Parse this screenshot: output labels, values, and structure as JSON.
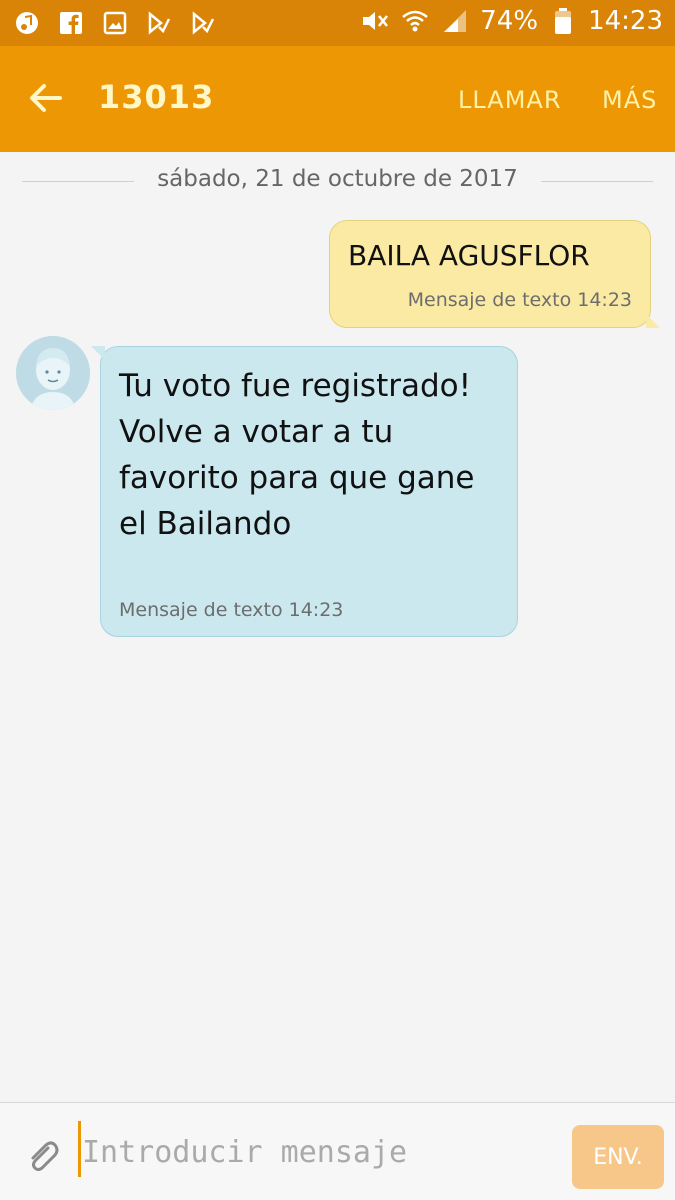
{
  "status_bar": {
    "battery": "74%",
    "time": "14:23",
    "left_icons": [
      "music-note-icon",
      "facebook-icon",
      "image-icon",
      "play-store-icon",
      "play-store-icon"
    ],
    "right_icons": [
      "mute-icon",
      "wifi-icon",
      "signal-icon",
      "battery-icon"
    ]
  },
  "app_bar": {
    "title": "13013",
    "call_label": "LLAMAR",
    "more_label": "MÁS",
    "accent_color": "#ee9704"
  },
  "conversation": {
    "date": "sábado, 21 de octubre de 2017",
    "messages": [
      {
        "direction": "outgoing",
        "text": "BAILA AGUSFLOR",
        "meta": "Mensaje de texto 14:23",
        "bubble_color": "#faeaa3"
      },
      {
        "direction": "incoming",
        "text": "Tu voto fue registrado! Volve a votar a tu favorito para que gane el Bailando",
        "meta": "Mensaje de texto 14:23",
        "bubble_color": "#cbe8ef"
      }
    ]
  },
  "composer": {
    "placeholder": "Introducir mensaje",
    "send_label": "ENV."
  }
}
